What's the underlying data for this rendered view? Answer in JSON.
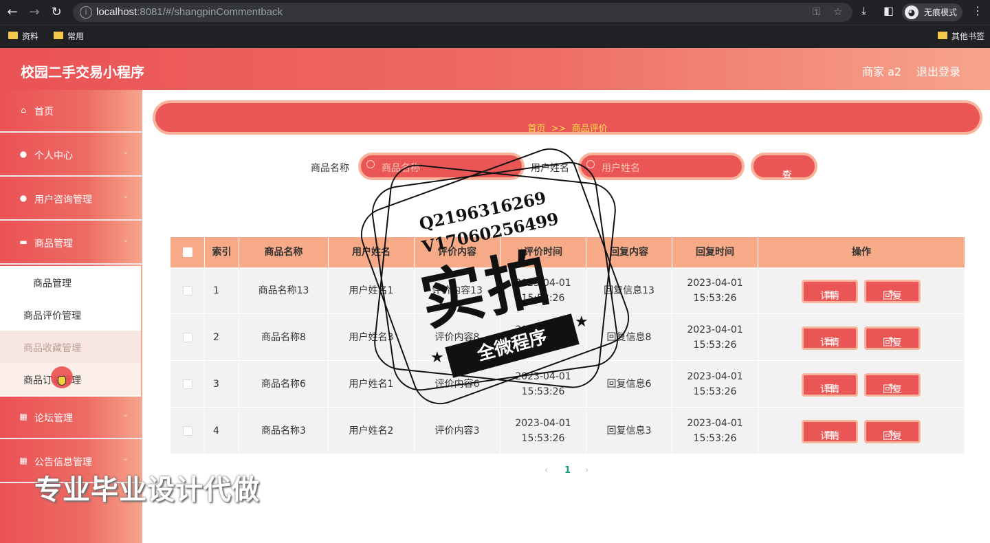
{
  "browser": {
    "url_host": "localhost",
    "url_rest": ":8081/#/shangpinCommentback",
    "profile_label": "无痕模式",
    "bookmarks": [
      "资料",
      "常用"
    ],
    "other_bookmarks": "其他书签"
  },
  "app": {
    "title": "校园二手交易小程序",
    "user_label": "商家 a2",
    "logout_label": "退出登录"
  },
  "sidebar": {
    "items": [
      {
        "label": "首页",
        "icon": "home-icon"
      },
      {
        "label": "个人中心",
        "icon": "user-icon"
      },
      {
        "label": "用户咨询管理",
        "icon": "user-icon"
      },
      {
        "label": "商品管理",
        "icon": "briefcase-icon"
      },
      {
        "label": "论坛管理",
        "icon": "grid-icon"
      },
      {
        "label": "公告信息管理",
        "icon": "grid-icon"
      }
    ],
    "submenu": [
      "商品管理",
      "商品评价管理",
      "商品收藏管理",
      "商品订单管理"
    ]
  },
  "breadcrumb": {
    "home": "首页",
    "sep": ">>",
    "current": "商品评价"
  },
  "search": {
    "field1_label": "商品名称",
    "field1_placeholder": "商品名称",
    "field2_label": "用户姓名",
    "field2_placeholder": "用户姓名",
    "button_label": "查询"
  },
  "table": {
    "headers": [
      "索引",
      "商品名称",
      "用户姓名",
      "评价内容",
      "评价时间",
      "回复内容",
      "回复时间",
      "操作"
    ],
    "rows": [
      {
        "index": "1",
        "product": "商品名称13",
        "user": "用户姓名1",
        "content": "评价内容13",
        "time": "2023-04-01 15:53:26",
        "reply": "回复信息13",
        "reply_time": "2023-04-01 15:53:26"
      },
      {
        "index": "2",
        "product": "商品名称8",
        "user": "用户姓名3",
        "content": "评价内容8",
        "time": "2023-04-01 15:53:26",
        "reply": "回复信息8",
        "reply_time": "2023-04-01 15:53:26"
      },
      {
        "index": "3",
        "product": "商品名称6",
        "user": "用户姓名1",
        "content": "评价内容6",
        "time": "2023-04-01 15:53:26",
        "reply": "回复信息6",
        "reply_time": "2023-04-01 15:53:26"
      },
      {
        "index": "4",
        "product": "商品名称3",
        "user": "用户姓名2",
        "content": "评价内容3",
        "time": "2023-04-01 15:53:26",
        "reply": "回复信息3",
        "reply_time": "2023-04-01 15:53:26"
      }
    ],
    "detail_label": "详情",
    "reply_label": "回复"
  },
  "pagination": {
    "prev": "‹",
    "current": "1",
    "next": "›"
  },
  "watermark": {
    "qq": "Q2196316269",
    "v": "V17060256499",
    "big": "实拍",
    "ribbon": "全微程序",
    "bottom": "专业毕业设计代做"
  },
  "colors": {
    "primary": "#ea5556",
    "accent_border": "#f8b39a",
    "header_bg": "#f6aa87",
    "crumb_text": "#ffe14a"
  }
}
